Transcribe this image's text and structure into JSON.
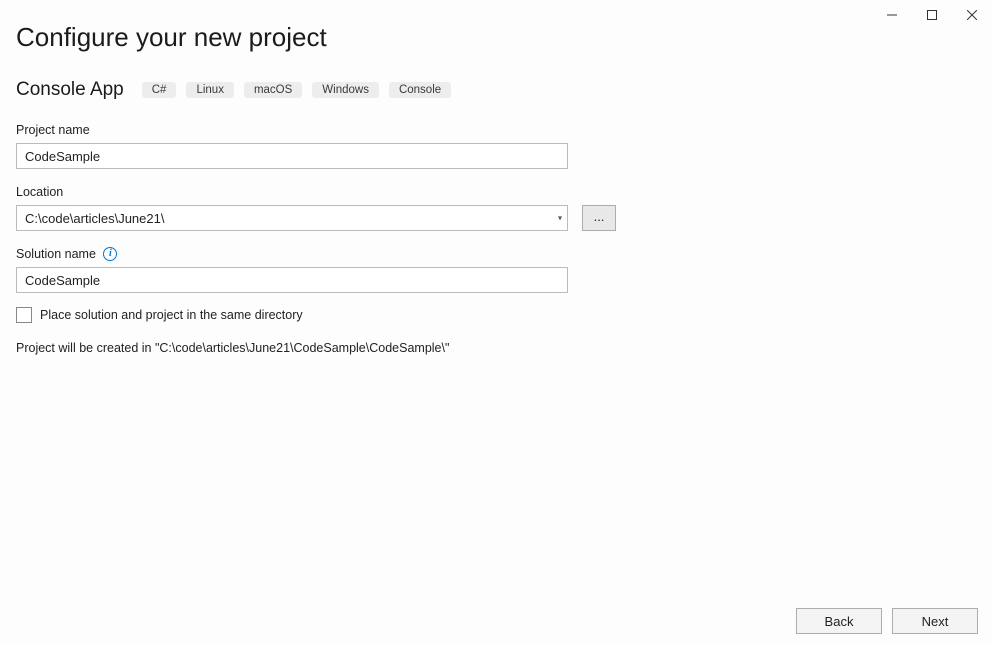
{
  "window": {
    "title": "Configure your new project"
  },
  "template": {
    "name": "Console App",
    "tags": [
      "C#",
      "Linux",
      "macOS",
      "Windows",
      "Console"
    ]
  },
  "fields": {
    "project_name": {
      "label": "Project name",
      "value": "CodeSample"
    },
    "location": {
      "label": "Location",
      "value": "C:\\code\\articles\\June21\\",
      "browse_label": "..."
    },
    "solution_name": {
      "label": "Solution name",
      "value": "CodeSample"
    },
    "same_directory": {
      "label": "Place solution and project in the same directory",
      "checked": false
    }
  },
  "summary": "Project will be created in \"C:\\code\\articles\\June21\\CodeSample\\CodeSample\\\"",
  "footer": {
    "back_label": "Back",
    "next_label": "Next"
  }
}
